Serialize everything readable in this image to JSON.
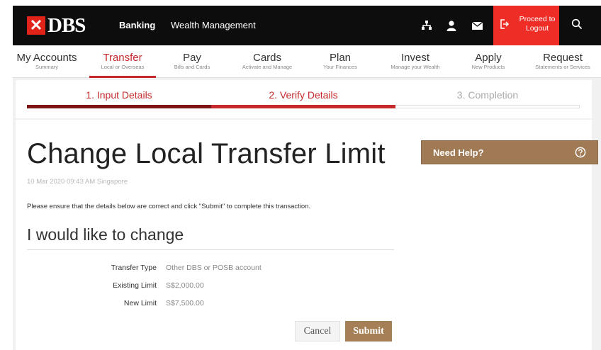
{
  "header": {
    "logo_text": "DBS",
    "nav": [
      "Banking",
      "Wealth Management"
    ],
    "logout_label": "Proceed to Logout",
    "icons": [
      "network-icon",
      "user-icon",
      "mail-icon",
      "logout-icon",
      "search-icon"
    ]
  },
  "main_nav": [
    {
      "title": "My Accounts",
      "sub": "Summary"
    },
    {
      "title": "Transfer",
      "sub": "Local or Overseas",
      "active": true
    },
    {
      "title": "Pay",
      "sub": "Bills and Cards"
    },
    {
      "title": "Cards",
      "sub": "Activate and Manage"
    },
    {
      "title": "Plan",
      "sub": "Your Finances"
    },
    {
      "title": "Invest",
      "sub": "Manage your Wealth"
    },
    {
      "title": "Apply",
      "sub": "New Products"
    },
    {
      "title": "Request",
      "sub": "Statements or Services"
    }
  ],
  "steps": [
    {
      "label": "1. Input Details",
      "state": "done"
    },
    {
      "label": "2. Verify Details",
      "state": "current"
    },
    {
      "label": "3. Completion",
      "state": "pending"
    }
  ],
  "page": {
    "title": "Change Local Transfer Limit",
    "timestamp": "10 Mar 2020 09:43 AM Singapore",
    "instructions": "Please ensure that the details below are correct and click \"Submit\" to complete this transaction.",
    "section_heading": "I would like to change"
  },
  "details": [
    {
      "label": "Transfer Type",
      "value": "Other DBS or POSB account"
    },
    {
      "label": "Existing Limit",
      "value": "S$2,000.00"
    },
    {
      "label": "New Limit",
      "value": "S$7,500.00"
    }
  ],
  "buttons": {
    "cancel": "Cancel",
    "submit": "Submit"
  },
  "help": {
    "label": "Need Help?"
  },
  "colors": {
    "brand_red": "#ee2e26",
    "active_red": "#c6282b",
    "gold": "#a58057",
    "topbar": "#0d0d0d"
  }
}
